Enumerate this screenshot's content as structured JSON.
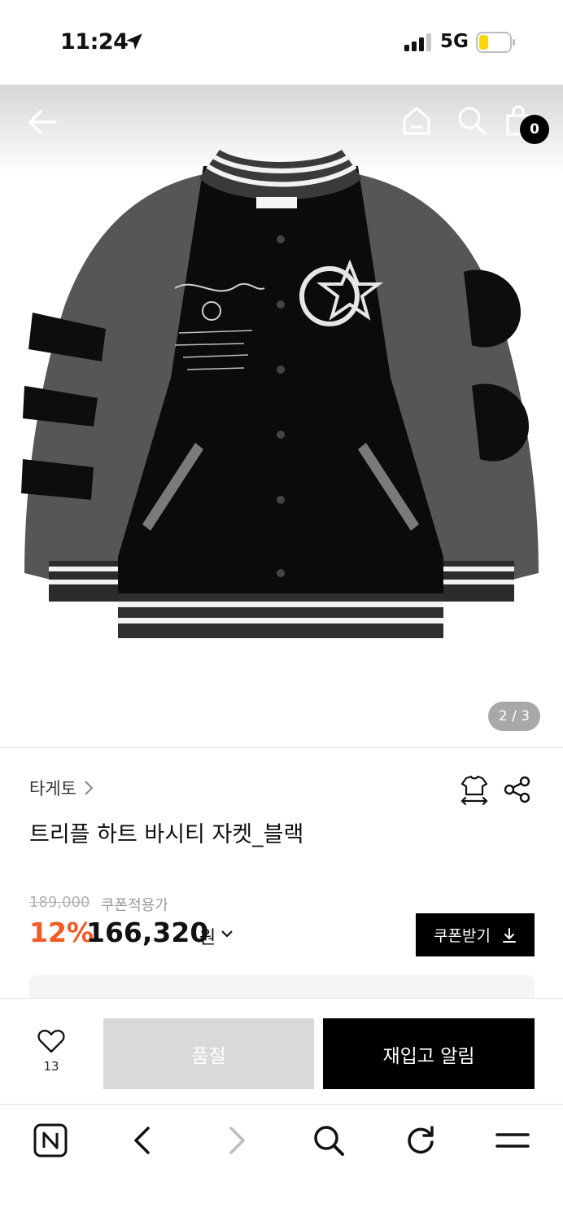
{
  "status_bar": {
    "time": "11:24",
    "network": "5G"
  },
  "image_nav": {
    "cart_count": "0",
    "counter": "2 / 3"
  },
  "product": {
    "brand": "타게토",
    "title": "트리플 하트 바시티 자켓_블랙",
    "original_price": "189,000",
    "coupon_note": "쿠폰적용가",
    "discount_rate": "12%",
    "sale_price": "166,320",
    "price_unit": "원"
  },
  "coupon_button": {
    "label": "쿠폰받기"
  },
  "purchase_bar": {
    "like_count": "13",
    "soldout_label": "품절",
    "restock_label": "재입고 알림"
  },
  "icons": {
    "status": [
      "location-arrow-icon",
      "signal-icon",
      "battery-icon"
    ],
    "image_nav": [
      "back-arrow-icon",
      "home-icon",
      "search-icon",
      "cart-icon"
    ],
    "product": [
      "chevron-right-icon",
      "size-fit-icon",
      "share-icon",
      "chevron-down-icon",
      "download-icon",
      "heart-icon"
    ],
    "browser": [
      "naver-n-icon",
      "back-icon",
      "forward-icon",
      "search-icon",
      "refresh-icon",
      "menu-icon"
    ]
  },
  "colors": {
    "discount": "#f15a22",
    "primary_button": "#000000",
    "disabled_button": "#d9d9d9",
    "battery": "#ffd60a"
  }
}
